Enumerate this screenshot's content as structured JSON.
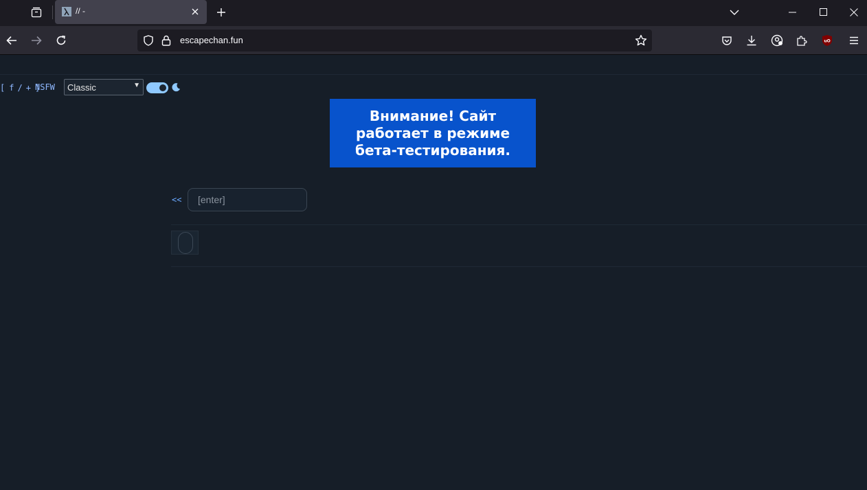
{
  "browser": {
    "tab": {
      "title": "// -"
    },
    "url": "escapechan.fun",
    "icons": {
      "tab_list": "tab-list-icon",
      "new_tab": "plus-icon",
      "minimize": "minimize-icon",
      "maximize": "maximize-icon",
      "close": "close-icon",
      "back": "arrow-left-icon",
      "forward": "arrow-right-icon",
      "reload": "reload-icon",
      "bookmark": "star-icon",
      "pocket": "pocket-icon",
      "downloads": "download-icon",
      "account": "account-icon",
      "extensions": "puzzle-icon",
      "ublock": "ublock-icon",
      "menu": "hamburger-menu-icon"
    }
  },
  "page": {
    "board_nav": {
      "open": "[",
      "f": "f",
      "slash": "/",
      "plus": "+",
      "close": "]"
    },
    "nsfw_label": "NSFW",
    "style_select": {
      "value": "Classic"
    },
    "theme_toggle": {
      "on": true
    },
    "banner": {
      "text": "Внимание! Сайт работает в режиме бета-тестирования."
    },
    "back_link": "<<",
    "enter_input": {
      "placeholder": "[enter]",
      "value": ""
    },
    "colors": {
      "background": "#161e28",
      "banner": "#0853cc",
      "link": "#8fb8ff",
      "toggle": "#8fc9ff"
    }
  }
}
